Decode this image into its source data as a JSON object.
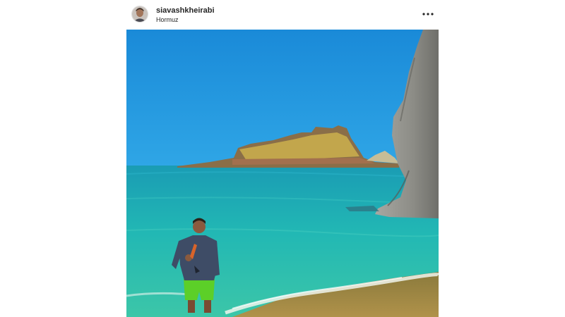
{
  "post": {
    "username": "siavashkheirabi",
    "location": "Hormuz",
    "more_icon": "more-options-icon",
    "image": {
      "sky_color": "#1f8fdc",
      "sea_color": "#1fb4b6",
      "island_color": "#b9a050",
      "cliff_color": "#8a8a86"
    }
  }
}
